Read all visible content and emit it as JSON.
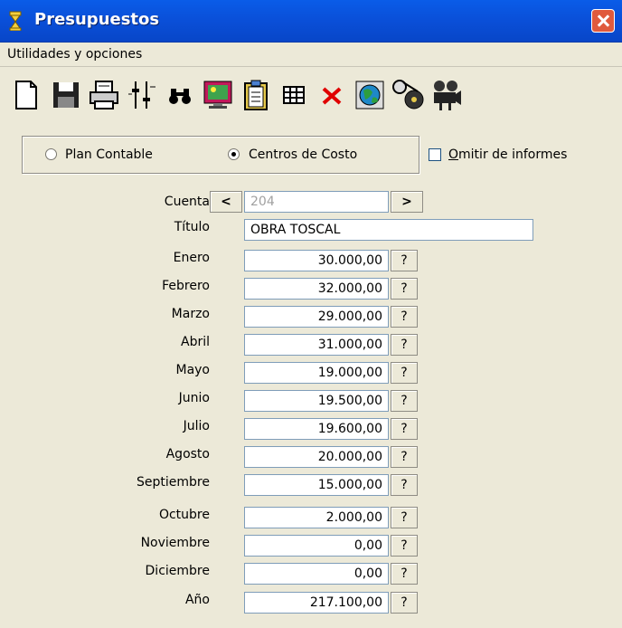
{
  "window": {
    "title": "Presupuestos"
  },
  "menu": {
    "items": [
      "Utilidades y opciones"
    ]
  },
  "toolbar": {
    "icons": [
      "new-document-icon",
      "save-icon",
      "print-icon",
      "settings-sliders-icon",
      "binoculars-icon",
      "monitor-image-icon",
      "clipboard-icon",
      "grid-table-icon",
      "delete-x-icon",
      "globe-icon",
      "film-reel-icon",
      "movie-camera-icon"
    ]
  },
  "options": {
    "radio_plan": "Plan Contable",
    "radio_centros": "Centros de Costo",
    "selected": "Centros de Costo",
    "omitir_label": "Omitir de informes",
    "omitir_checked": false
  },
  "form": {
    "cuenta_label": "Cuenta",
    "cuenta_prev": "<",
    "cuenta_value": "204",
    "cuenta_next": ">",
    "titulo_label": "Título",
    "titulo_value": "OBRA TOSCAL",
    "help_label": "?",
    "months": [
      {
        "label": "Enero",
        "value": "30.000,00"
      },
      {
        "label": "Febrero",
        "value": "32.000,00"
      },
      {
        "label": "Marzo",
        "value": "29.000,00"
      },
      {
        "label": "Abril",
        "value": "31.000,00"
      },
      {
        "label": "Mayo",
        "value": "19.000,00"
      },
      {
        "label": "Junio",
        "value": "19.500,00"
      },
      {
        "label": "Julio",
        "value": "19.600,00"
      },
      {
        "label": "Agosto",
        "value": "20.000,00"
      },
      {
        "label": "Septiembre",
        "value": "15.000,00"
      },
      {
        "label": "Octubre",
        "value": "2.000,00"
      },
      {
        "label": "Noviembre",
        "value": "0,00"
      },
      {
        "label": "Diciembre",
        "value": "0,00"
      },
      {
        "label": "Año",
        "value": "217.100,00"
      }
    ]
  }
}
